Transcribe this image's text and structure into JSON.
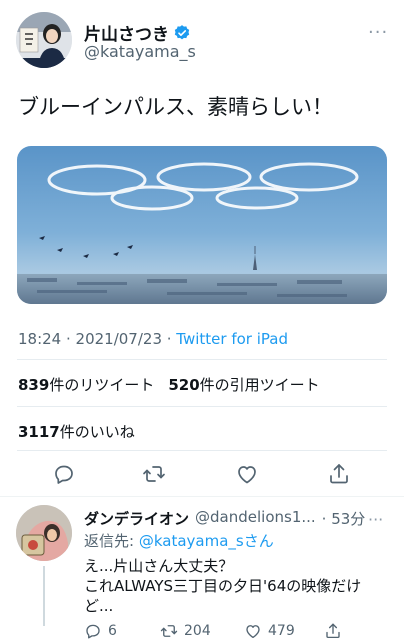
{
  "tweet": {
    "display_name": "片山さつき",
    "handle": "@katayama_s",
    "text": "ブルーインパルス、素晴らしい！",
    "timestamp": "18:24 · 2021/07/23 · ",
    "source": "Twitter for iPad",
    "more_label": "···"
  },
  "stats": {
    "retweets_count": "839",
    "retweets_label": "件のリツイート",
    "quotes_count": "520",
    "quotes_label": "件の引用ツイート",
    "likes_count": "3117",
    "likes_label": "件のいいね"
  },
  "actions": {
    "icons": [
      "reply-icon",
      "retweet-icon",
      "like-icon",
      "share-icon"
    ]
  },
  "reply": {
    "display_name": "ダンデライオン",
    "handle": "@dandelions1...",
    "time": "· 53分",
    "more_label": "···",
    "replying_prefix": "返信先: ",
    "replying_to": "@katayama_sさん",
    "text_line1": "え...片山さん大丈夫？",
    "text_line2": "これALWAYS三丁目の夕日'64の映像だけ",
    "text_line3": "ど...",
    "reply_count": "6",
    "retweet_count": "204",
    "like_count": "479"
  },
  "colors": {
    "accent": "#1d9bf0",
    "text": "#0f1419",
    "secondary": "#536471"
  }
}
